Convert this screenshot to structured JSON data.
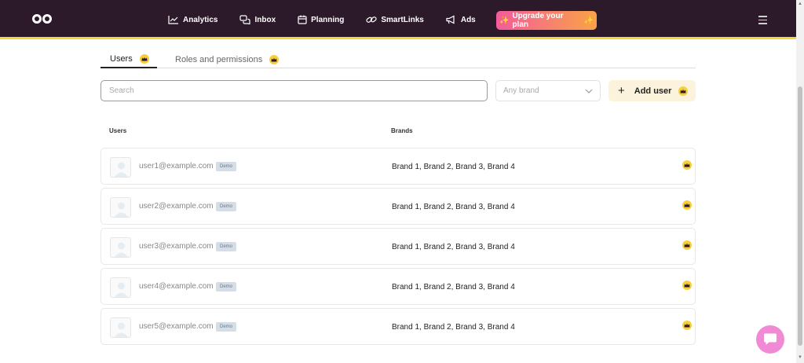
{
  "nav": {
    "items": [
      {
        "label": "Analytics",
        "icon": "chart-line-icon"
      },
      {
        "label": "Inbox",
        "icon": "chat-bubbles-icon"
      },
      {
        "label": "Planning",
        "icon": "calendar-icon"
      },
      {
        "label": "SmartLinks",
        "icon": "link-icon"
      },
      {
        "label": "Ads",
        "icon": "megaphone-icon"
      }
    ],
    "upgrade_label": "Upgrade your plan",
    "upgrade_spark": "✨"
  },
  "tabs": {
    "users": "Users",
    "roles": "Roles and permissions"
  },
  "search": {
    "placeholder": "Search",
    "value": ""
  },
  "brand_filter": {
    "selected": "Any brand"
  },
  "add_user_label": "Add user",
  "add_user_plus": "+",
  "table": {
    "headers": {
      "users": "Users",
      "brands": "Brands"
    },
    "rows": [
      {
        "email": "user1@example.com",
        "tag": "Demo",
        "brands": "Brand 1, Brand 2, Brand 3, Brand 4"
      },
      {
        "email": "user2@example.com",
        "tag": "Demo",
        "brands": "Brand 1, Brand 2, Brand 3, Brand 4"
      },
      {
        "email": "user3@example.com",
        "tag": "Demo",
        "brands": "Brand 1, Brand 2, Brand 3, Brand 4"
      },
      {
        "email": "user4@example.com",
        "tag": "Demo",
        "brands": "Brand 1, Brand 2, Brand 3, Brand 4"
      },
      {
        "email": "user5@example.com",
        "tag": "Demo",
        "brands": "Brand 1, Brand 2, Brand 3, Brand 4"
      }
    ]
  },
  "colors": {
    "topbar": "#2c1a2b",
    "accent_yellow": "#f4d83a",
    "upgrade_gradient_start": "#f45b9b",
    "upgrade_gradient_end": "#f9a347",
    "chat_bubble": "#f08ad5"
  }
}
